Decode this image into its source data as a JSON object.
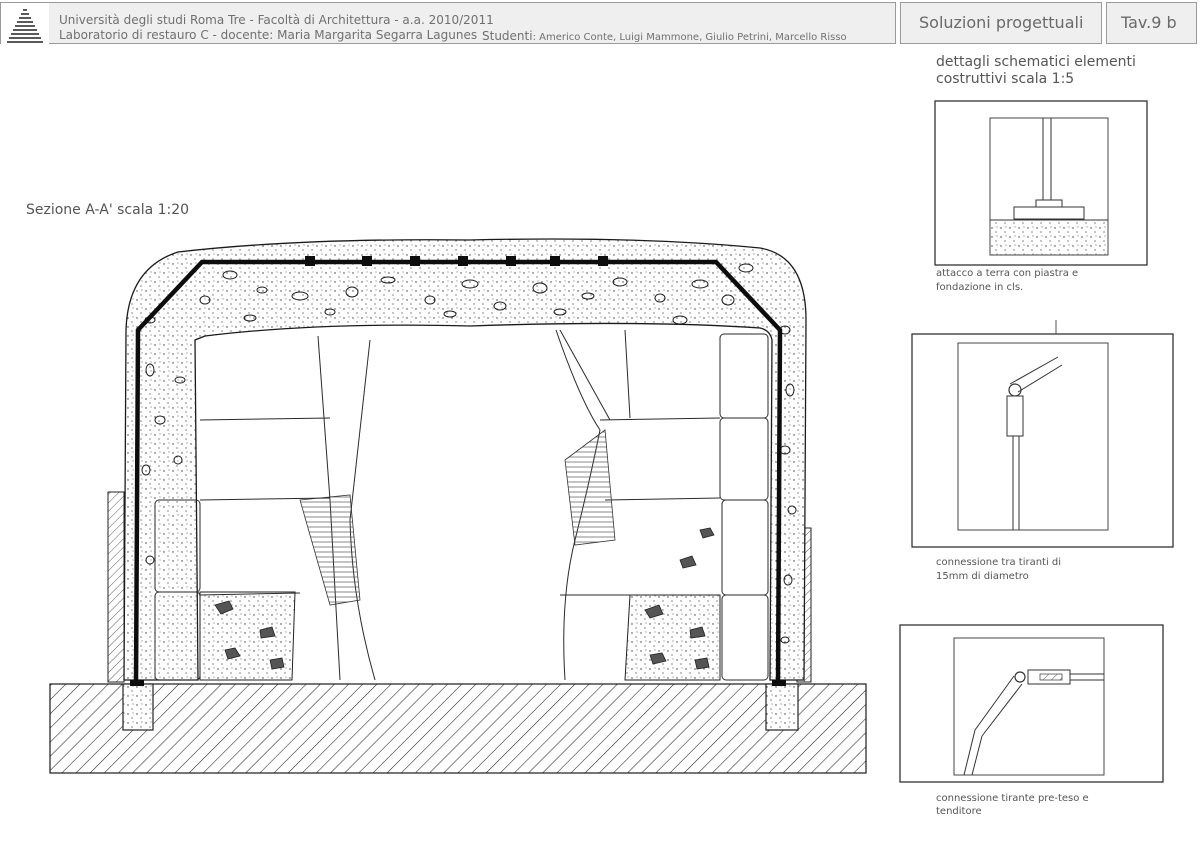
{
  "header": {
    "university_line": "Università degli studi Roma Tre - Facoltà di Architettura - a.a. 2010/2011",
    "lab_line": "Laboratorio di restauro C - docente: Maria Margarita Segarra Lagunes",
    "students_label": "Studenti",
    "students_names": ": Americo Conte, Luigi Mammone, Giulio Petrini, Marcello Risso",
    "subject": "Soluzioni progettuali",
    "tav": "Tav.9 b"
  },
  "section": {
    "title": "Sezione A-A' scala 1:20"
  },
  "details": {
    "title_line1": "dettagli schematici elementi",
    "title_line2": "costruttivi scala 1:5",
    "items": [
      {
        "caption_line1": "attacco a terra con piastra e",
        "caption_line2": "fondazione in cls."
      },
      {
        "caption_line1": "connessione tra tiranti di",
        "caption_line2": "15mm di diametro"
      },
      {
        "caption_line1": "connessione tirante pre-teso e",
        "caption_line2": "tenditore"
      }
    ]
  },
  "colors": {
    "header_bg": "#efefef",
    "header_border": "#9a9a9a",
    "ink": "#1a1a1a",
    "text": "#555555"
  }
}
